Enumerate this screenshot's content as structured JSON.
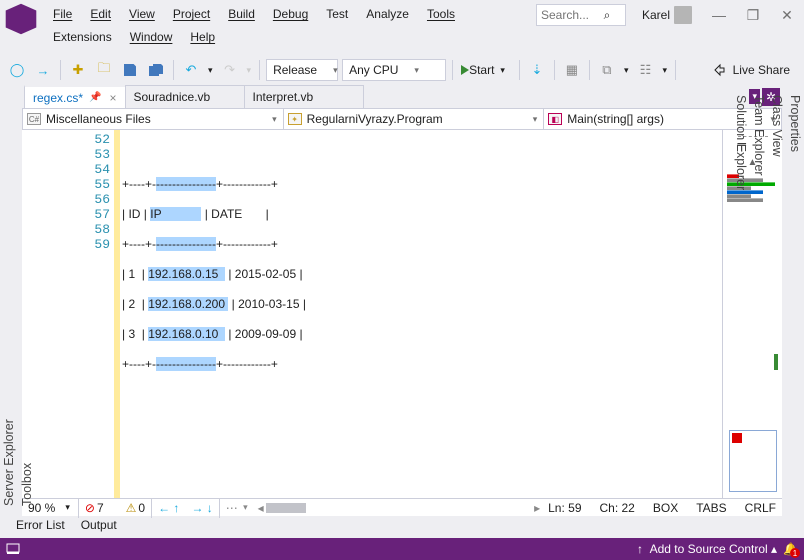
{
  "menu": [
    "File",
    "Edit",
    "View",
    "Project",
    "Build",
    "Debug",
    "Test",
    "Analyze",
    "Tools",
    "Extensions",
    "Window",
    "Help"
  ],
  "search_placeholder": "Search...",
  "user": "Karel",
  "toolbar": {
    "config": "Release",
    "platform": "Any CPU",
    "start": "Start",
    "live": "Live Share"
  },
  "tabs": {
    "t0": "regex.cs*",
    "t1": "Souradnice.vb",
    "t2": "Interpret.vb"
  },
  "nav": {
    "a": "Miscellaneous Files",
    "b": "RegularniVyrazy.Program",
    "c": "Main(string[] args)"
  },
  "lines": {
    "l0": "52",
    "l1": "53",
    "l2": "54",
    "l3": "55",
    "l4": "56",
    "l5": "57",
    "l6": "58",
    "l7": "59"
  },
  "code": {
    "r1": {
      "a": "+----+-",
      "sel": "---------------",
      "b": "+------------+"
    },
    "r2": {
      "a": "| ID | ",
      "sel": "IP            ",
      "b": " | DATE       |"
    },
    "r3": {
      "a": "+----+-",
      "sel": "---------------",
      "b": "+------------+"
    },
    "r4": {
      "a": "| 1  | ",
      "sel": "192.168.0.15  ",
      "b": " | 2015-02-05 |"
    },
    "r5": {
      "a": "| 2  | ",
      "sel": "192.168.0.200 ",
      "b": " | 2010-03-15 |"
    },
    "r6": {
      "a": "| 3  | ",
      "sel": "192.168.0.10  ",
      "b": " | 2009-09-09 |"
    },
    "r7": {
      "a": "+----+-",
      "sel": "---------------",
      "b": "+------------+"
    }
  },
  "status": {
    "zoom": "90 %",
    "errors": "7",
    "warnings": "0",
    "ln": "Ln: 59",
    "ch": "Ch: 22",
    "ins": "BOX",
    "tabs": "TABS",
    "eol": "CRLF"
  },
  "bottom": {
    "err": "Error List",
    "out": "Output"
  },
  "footer": {
    "scc": "Add to Source Control",
    "notif": "1"
  },
  "right": [
    "Properties",
    "Class View",
    "Team Explorer",
    "Solution Explorer"
  ],
  "left": [
    "Server Explorer",
    "Toolbox"
  ]
}
